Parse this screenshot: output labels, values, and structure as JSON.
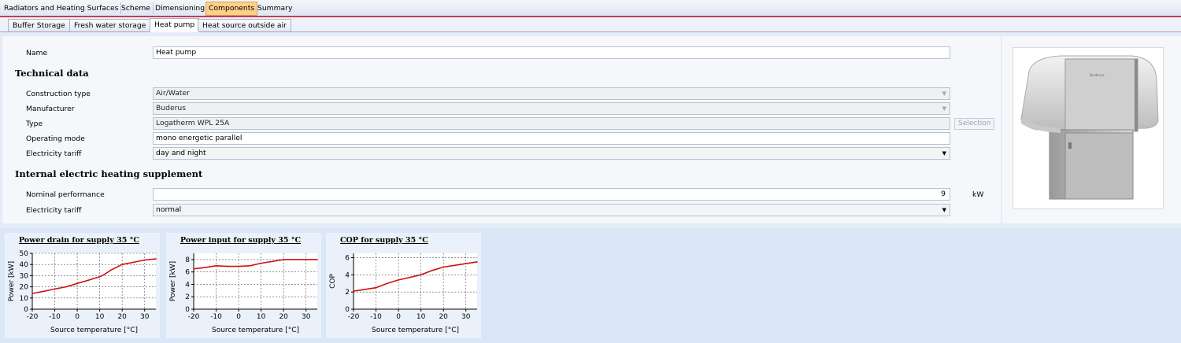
{
  "main_tabs": [
    "Radiators and Heating Surfaces",
    "Scheme",
    "Dimensioning",
    "Components",
    "Summary"
  ],
  "sub_tabs": [
    "Buffer Storage",
    "Fresh water storage",
    "Heat pump",
    "Heat source outside air"
  ],
  "form": {
    "name_label": "Name",
    "name_value": "Heat pump",
    "technical_heading": "Technical data",
    "construction_label": "Construction type",
    "construction_value": "Air/Water",
    "manufacturer_label": "Manufacturer",
    "manufacturer_value": "Buderus",
    "type_label": "Type",
    "type_value": "Logatherm WPL 25A",
    "selection_button": "Selection",
    "operating_label": "Operating mode",
    "operating_value": "mono energetic parallel",
    "tariff_label": "Electricity tariff",
    "tariff_value": "day and night",
    "supplement_heading": "Internal electric heating supplement",
    "nominal_label": "Nominal performance",
    "nominal_value": "9",
    "nominal_unit": "kW",
    "tariff2_label": "Electricity tariff",
    "tariff2_value": "normal"
  },
  "product_image": {
    "brand_text": "Buderus"
  },
  "chart_data": [
    {
      "type": "line",
      "title": "Power drain for supply 35 °C",
      "xlabel": "Source temperature [°C]",
      "ylabel": "Power [kW]",
      "xlim": [
        -20,
        35
      ],
      "ylim": [
        0,
        50
      ],
      "xticks": [
        -20,
        -10,
        0,
        10,
        20,
        30
      ],
      "yticks": [
        0,
        10,
        20,
        30,
        40,
        50
      ],
      "ytick_labels": [
        "0",
        "10",
        "20",
        "30",
        "40",
        "50"
      ],
      "grid": true,
      "color": "#cc1111",
      "x": [
        -20,
        -15,
        -10,
        -5,
        0,
        5,
        10,
        12,
        15,
        20,
        25,
        30,
        35
      ],
      "y": [
        14,
        16,
        18,
        20,
        23,
        26,
        29,
        31,
        35,
        40,
        42,
        44,
        45
      ]
    },
    {
      "type": "line",
      "title": "Power input for supply 35 °C",
      "xlabel": "Source temperature [°C]",
      "ylabel": "Power [kW]",
      "xlim": [
        -20,
        35
      ],
      "ylim": [
        0,
        9
      ],
      "xticks": [
        -20,
        -10,
        0,
        10,
        20,
        30
      ],
      "yticks": [
        0,
        2,
        4,
        6,
        8
      ],
      "ytick_labels": [
        "0",
        "2",
        "4",
        "6",
        "8"
      ],
      "grid": true,
      "color": "#cc1111",
      "x": [
        -20,
        -15,
        -10,
        -5,
        0,
        5,
        10,
        15,
        20,
        25,
        30,
        35
      ],
      "y": [
        6.5,
        6.7,
        7.0,
        6.9,
        6.9,
        7.0,
        7.4,
        7.7,
        8.0,
        8.0,
        8.0,
        8.0
      ]
    },
    {
      "type": "line",
      "title": "COP for supply  35 °C",
      "xlabel": "Source temperature [°C]",
      "ylabel": "COP",
      "xlim": [
        -20,
        35
      ],
      "ylim": [
        0,
        6.5
      ],
      "xticks": [
        -20,
        -10,
        0,
        10,
        20,
        30
      ],
      "yticks": [
        0,
        2,
        4,
        6
      ],
      "ytick_labels": [
        "0",
        "2",
        "4",
        "6"
      ],
      "grid": true,
      "color": "#cc1111",
      "x": [
        -20,
        -15,
        -10,
        -5,
        0,
        5,
        10,
        15,
        20,
        25,
        30,
        35
      ],
      "y": [
        2.1,
        2.3,
        2.5,
        3.0,
        3.4,
        3.7,
        4.0,
        4.5,
        4.9,
        5.1,
        5.3,
        5.5
      ]
    }
  ]
}
